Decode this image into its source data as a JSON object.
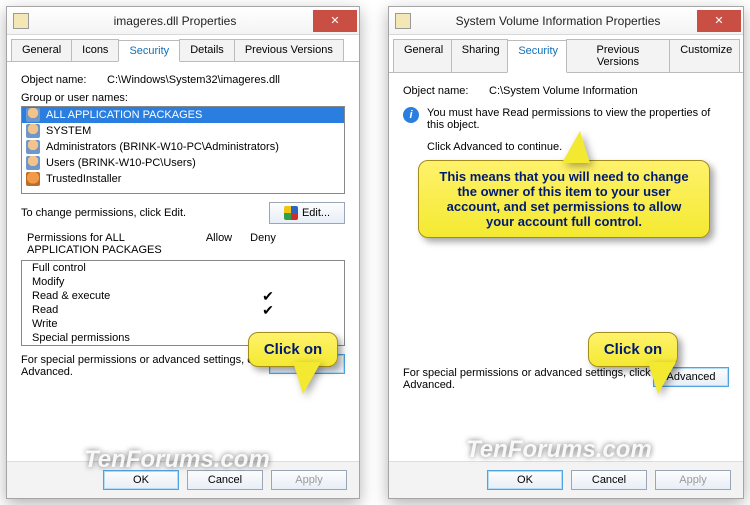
{
  "left": {
    "title": "imageres.dll Properties",
    "tabs": [
      "General",
      "Icons",
      "Security",
      "Details",
      "Previous Versions"
    ],
    "active_tab": "Security",
    "object_label": "Object name:",
    "object_path": "C:\\Windows\\System32\\imageres.dll",
    "group_label": "Group or user names:",
    "principals": [
      "ALL APPLICATION PACKAGES",
      "SYSTEM",
      "Administrators (BRINK-W10-PC\\Administrators)",
      "Users (BRINK-W10-PC\\Users)",
      "TrustedInstaller"
    ],
    "change_text": "To change permissions, click Edit.",
    "edit_btn": "Edit...",
    "perm_for": "Permissions for ALL APPLICATION PACKAGES",
    "cols": {
      "allow": "Allow",
      "deny": "Deny"
    },
    "perms": [
      {
        "name": "Full control",
        "allow": false
      },
      {
        "name": "Modify",
        "allow": false
      },
      {
        "name": "Read & execute",
        "allow": true
      },
      {
        "name": "Read",
        "allow": true
      },
      {
        "name": "Write",
        "allow": false
      },
      {
        "name": "Special permissions",
        "allow": false
      }
    ],
    "adv_text": "For special permissions or advanced settings, click Advanced.",
    "adv_btn": "Advanced",
    "buttons": {
      "ok": "OK",
      "cancel": "Cancel",
      "apply": "Apply"
    }
  },
  "right": {
    "title": "System Volume Information Properties",
    "tabs": [
      "General",
      "Sharing",
      "Security",
      "Previous Versions",
      "Customize"
    ],
    "active_tab": "Security",
    "object_label": "Object name:",
    "object_path": "C:\\System Volume Information",
    "warn1": "You must have Read permissions to view the properties of this object.",
    "warn2": "Click Advanced to continue.",
    "adv_text": "For special permissions or advanced settings, click Advanced.",
    "adv_btn": "Advanced",
    "buttons": {
      "ok": "OK",
      "cancel": "Cancel",
      "apply": "Apply"
    }
  },
  "callouts": {
    "click_on": "Click on",
    "explain": "This means that you will need to change the owner of this item to your user account, and set permissions to allow your account full control."
  },
  "watermark": "TenForums.com",
  "close_glyph": "✕",
  "check_glyph": "✔"
}
